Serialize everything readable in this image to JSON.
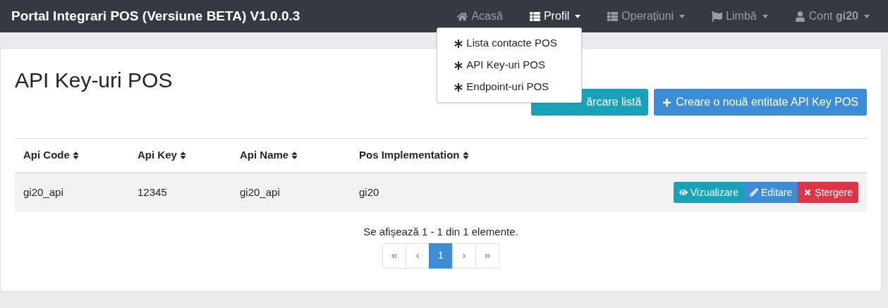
{
  "navbar": {
    "brand": "Portal Integrari POS (Versiune BETA) V1.0.0.3",
    "items": [
      {
        "kind": "home",
        "label": "Acasă",
        "selected": false,
        "dropdown": false
      },
      {
        "kind": "list",
        "label": "Profil",
        "selected": true,
        "dropdown": true
      },
      {
        "kind": "list",
        "label": "Operațiuni",
        "selected": false,
        "dropdown": true
      },
      {
        "kind": "flag",
        "label": "Limbă",
        "selected": false,
        "dropdown": true
      },
      {
        "kind": "user",
        "label": "Cont **gi20**",
        "selected": false,
        "dropdown": true
      }
    ],
    "open_menu": {
      "items": [
        "Lista contacte POS",
        "API Key-uri POS",
        "Endpoint-uri POS"
      ]
    }
  },
  "page": {
    "title": "API Key-uri POS",
    "reload_button": "ărcare listă",
    "create_button": "Creare o nouă entitate API Key POS"
  },
  "table": {
    "columns": [
      "Api Code",
      "Api Key",
      "Api Name",
      "Pos Implementation"
    ],
    "rows": [
      {
        "cells": [
          "gi20_api",
          "12345",
          "gi20_api",
          "gi20"
        ],
        "actions": [
          "Vizualizare",
          "Editare",
          "Ștergere"
        ]
      }
    ]
  },
  "pagination": {
    "summary": "Se afișează 1 - 1 din 1 elemente.",
    "pages": [
      {
        "label": "«",
        "selected": false
      },
      {
        "label": "‹",
        "selected": false
      },
      {
        "label": "1",
        "selected": true
      },
      {
        "label": "›",
        "selected": false
      },
      {
        "label": "»",
        "selected": false
      }
    ]
  }
}
